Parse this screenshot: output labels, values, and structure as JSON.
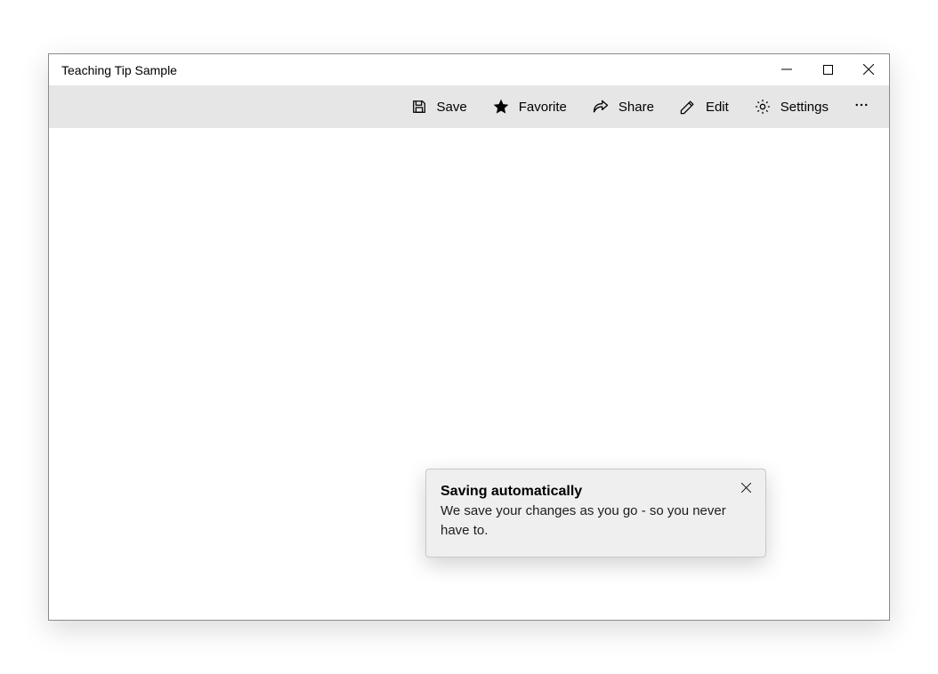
{
  "window": {
    "title": "Teaching Tip Sample"
  },
  "commandbar": {
    "save_label": "Save",
    "favorite_label": "Favorite",
    "share_label": "Share",
    "edit_label": "Edit",
    "settings_label": "Settings"
  },
  "teaching_tip": {
    "title": "Saving automatically",
    "body": "We save your changes as you go - so you never have to."
  }
}
